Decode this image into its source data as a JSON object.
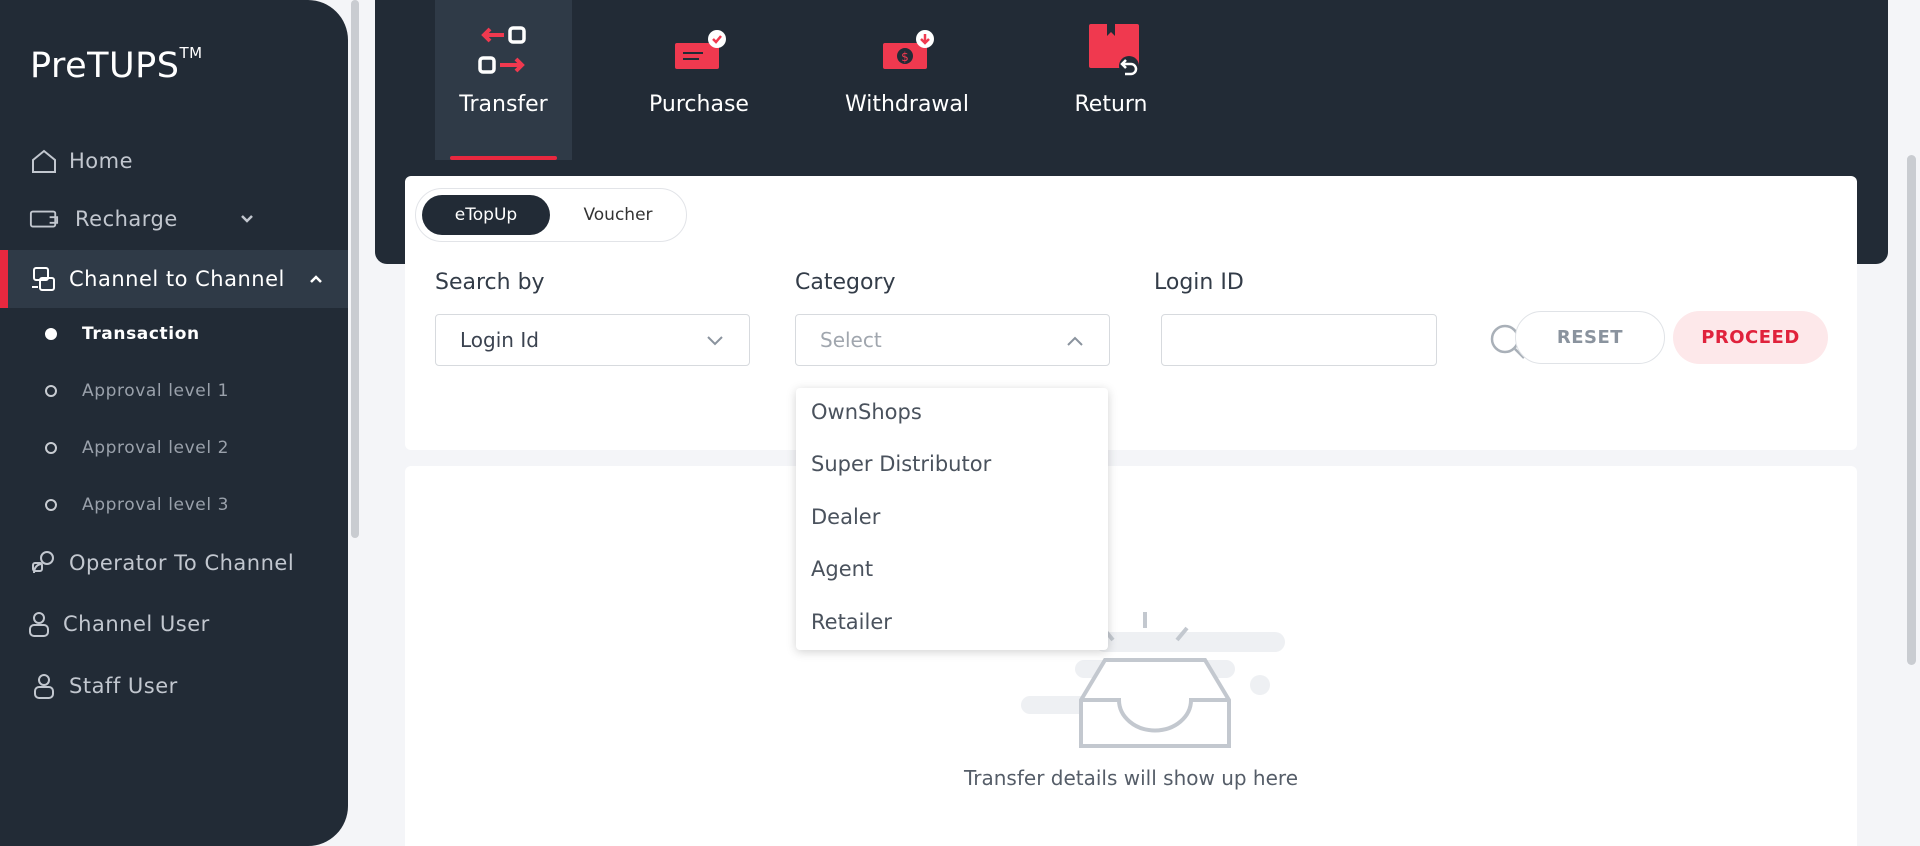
{
  "app": {
    "name": "PreTUPS",
    "trademark": "TM"
  },
  "sidebar": {
    "items": [
      {
        "label": "Home",
        "icon": "home-icon"
      },
      {
        "label": "Recharge",
        "icon": "recharge-icon"
      },
      {
        "label": "Channel to Channel",
        "icon": "channel-to-channel-icon"
      },
      {
        "label": "Operator To Channel",
        "icon": "operator-to-channel-icon"
      },
      {
        "label": "Channel User",
        "icon": "user-icon"
      },
      {
        "label": "Staff User",
        "icon": "user-icon"
      }
    ],
    "subitems": [
      {
        "label": "Transaction",
        "active": true
      },
      {
        "label": "Approval level 1",
        "active": false
      },
      {
        "label": "Approval level 2",
        "active": false
      },
      {
        "label": "Approval level 3",
        "active": false
      }
    ]
  },
  "types": [
    {
      "label": "Transfer",
      "icon": "transfer-icon",
      "active": true
    },
    {
      "label": "Purchase",
      "icon": "purchase-icon",
      "active": false
    },
    {
      "label": "Withdrawal",
      "icon": "withdrawal-icon",
      "active": false
    },
    {
      "label": "Return",
      "icon": "return-icon",
      "active": false
    }
  ],
  "toggle": {
    "options": [
      "eTopUp",
      "Voucher"
    ],
    "selected": "eTopUp"
  },
  "filters": {
    "search_by": {
      "label": "Search by",
      "value": "Login Id"
    },
    "category": {
      "label": "Category",
      "placeholder": "Select",
      "options": [
        "OwnShops",
        "Super Distributor",
        "Dealer",
        "Agent",
        "Retailer"
      ]
    },
    "login_id": {
      "label": "Login ID",
      "value": ""
    }
  },
  "buttons": {
    "reset": "RESET",
    "proceed": "PROCEED"
  },
  "empty_state": {
    "message": "Transfer details will show up here"
  },
  "colors": {
    "sidebar_bg": "#222b36",
    "accent": "#e8283f",
    "page_bg": "#f4f5f8"
  }
}
